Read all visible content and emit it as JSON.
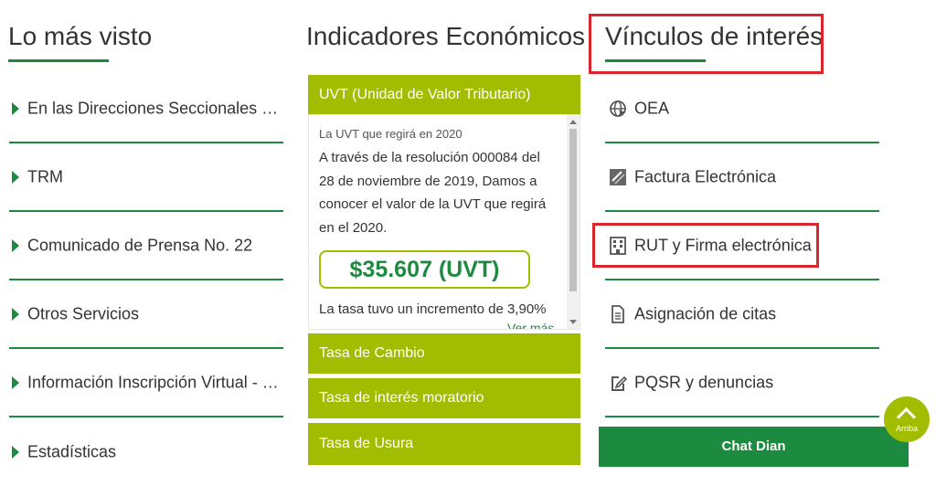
{
  "lo_mas_visto": {
    "title": "Lo más visto",
    "items": [
      {
        "label": "En las Direcciones Seccionales de Aduanas"
      },
      {
        "label": "TRM"
      },
      {
        "label": "Comunicado de Prensa No. 22"
      },
      {
        "label": "Otros Servicios"
      },
      {
        "label": "Información Inscripción Virtual - RUT"
      },
      {
        "label": "Estadísticas"
      }
    ]
  },
  "indicadores": {
    "title": "Indicadores Económicos",
    "open_panel": {
      "header": "UVT (Unidad de Valor Tributario)",
      "subtitle": "La UVT que regirá en 2020",
      "description": "A través de la resolución 000084 del 28 de noviembre de 2019, Damos a conocer el valor de la UVT que regirá en el 2020.",
      "value": "$35.607 (UVT)",
      "rate_text": "La tasa tuvo un incremento de 3,90%",
      "more_link": "Ver más"
    },
    "headers": [
      {
        "label": "Tasa de Cambio"
      },
      {
        "label": "Tasa de interés moratorio"
      },
      {
        "label": "Tasa de Usura"
      }
    ]
  },
  "vinculos": {
    "title": "Vínculos de interés",
    "items": [
      {
        "label": "OEA",
        "icon": "globe-icon"
      },
      {
        "label": "Factura Electrónica",
        "icon": "invoice-icon"
      },
      {
        "label": "RUT y Firma electrónica",
        "icon": "building-icon"
      },
      {
        "label": "Asignación de citas",
        "icon": "document-icon"
      },
      {
        "label": "PQSR y denuncias",
        "icon": "edit-icon"
      }
    ]
  },
  "chat": {
    "label": "Chat Dian"
  },
  "back_to_top": {
    "label": "Arriba"
  },
  "colors": {
    "brand_green": "#1c8b3f",
    "accent_lime": "#a2bd00",
    "highlight_red": "#d9262c"
  }
}
